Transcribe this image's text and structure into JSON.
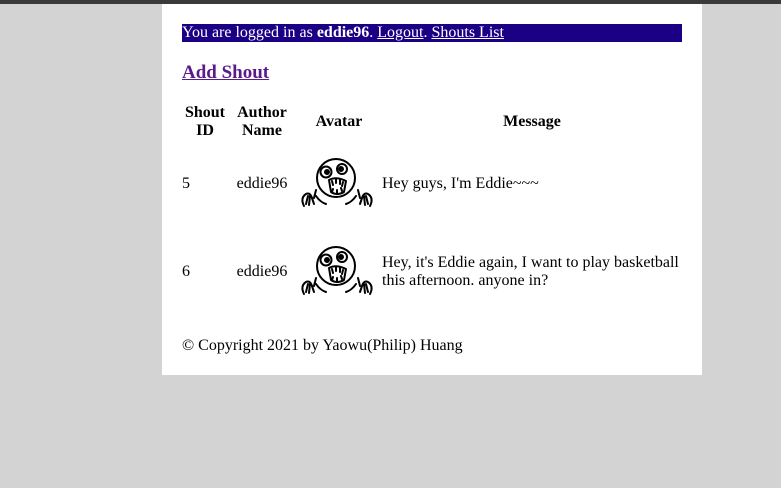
{
  "login_bar": {
    "prefix": "You are logged in as ",
    "username": "eddie96",
    "period": ".",
    "logout_label": "Logout",
    "period2": ".",
    "shouts_list_label": "Shouts List"
  },
  "add_shout_label": "Add Shout",
  "table": {
    "headers": {
      "id_line1": "Shout",
      "id_line2": "ID",
      "author_line1": "Author",
      "author_line2": "Name",
      "avatar": "Avatar",
      "message": "Message"
    },
    "rows": [
      {
        "id": "5",
        "author": "eddie96",
        "avatar_icon": "shocked-face-avatar-icon",
        "message": "Hey guys, I'm Eddie~~~"
      },
      {
        "id": "6",
        "author": "eddie96",
        "avatar_icon": "shocked-face-avatar-icon",
        "message": "Hey, it's Eddie again, I want to play basketball this afternoon. anyone in?"
      }
    ]
  },
  "footer": "© Copyright 2021 by Yaowu(Philip) Huang",
  "colors": {
    "page_background": "#d3d3d3",
    "content_background": "#ffffff",
    "login_bar_background": "#1b0085",
    "visited_link": "#5a1a8a"
  }
}
